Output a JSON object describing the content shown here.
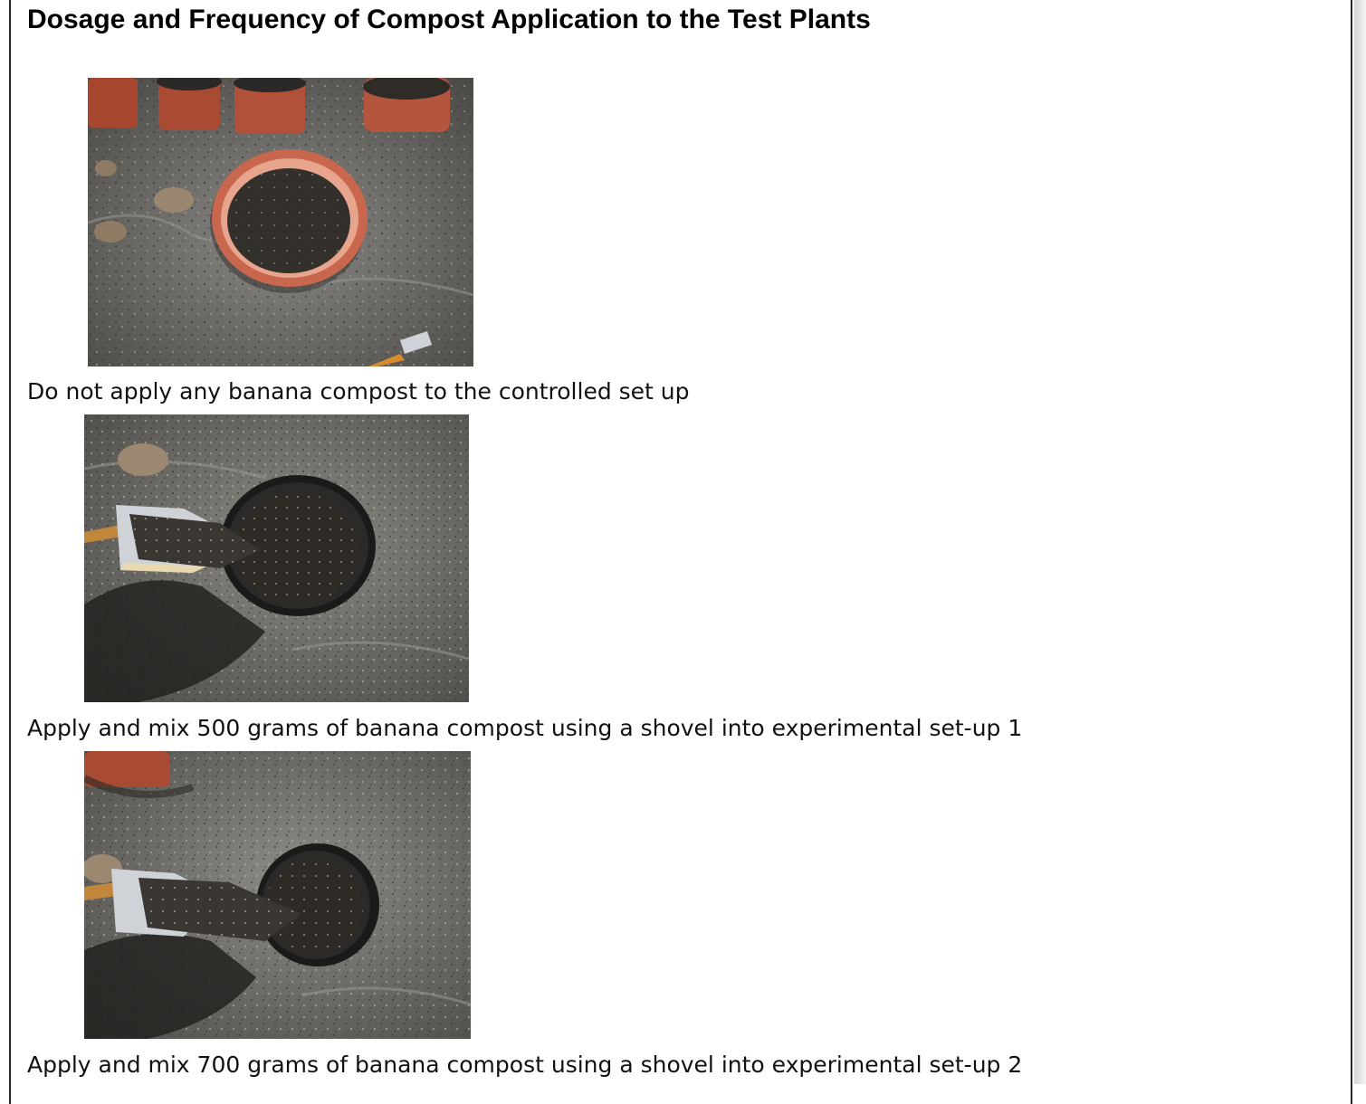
{
  "document": {
    "title": "Dosage and Frequency of Compost Application to the Test Plants",
    "steps": [
      {
        "caption": "Do not apply any banana compost to the controlled set up",
        "photo_icon": "pot-with-soil-photo"
      },
      {
        "caption": "Apply and mix 500 grams of banana compost using a shovel into experimental set-up 1",
        "photo_icon": "shovel-compost-photo"
      },
      {
        "caption": "Apply and mix 700 grams of banana compost using a shovel into experimental set-up 2",
        "photo_icon": "shovel-compost-photo"
      }
    ]
  },
  "colors": {
    "ground": "#6c6a66",
    "soil": "#2f2c28",
    "terracotta": "#b5533d",
    "black_pot": "#1e1e1e",
    "shovel_metal": "#c9ccd0"
  }
}
